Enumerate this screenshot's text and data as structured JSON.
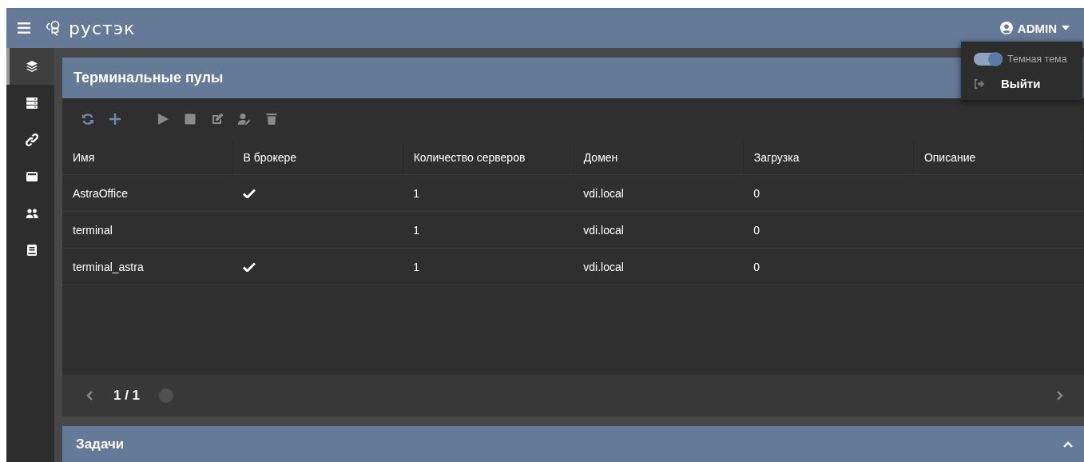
{
  "header": {
    "logo_text": "рустэк",
    "user": "ADMIN"
  },
  "user_menu": {
    "theme_toggle": {
      "label": "Темная тема",
      "on": true
    },
    "logout": "Выйти"
  },
  "sidebar": {
    "items": [
      {
        "selected": true
      },
      {
        "selected": false
      },
      {
        "selected": false
      },
      {
        "selected": false
      },
      {
        "selected": false
      },
      {
        "selected": false
      }
    ]
  },
  "panel": {
    "title": "Терминальные пулы",
    "toolbar": [
      {
        "disabled": false
      },
      {
        "disabled": false
      },
      {
        "disabled": true
      },
      {
        "disabled": true
      },
      {
        "disabled": true
      },
      {
        "disabled": true
      },
      {
        "disabled": true
      }
    ],
    "table": {
      "columns": [
        "Имя",
        "В брокере",
        "Количество серверов",
        "Домен",
        "Загрузка",
        "Описание"
      ],
      "rows": [
        {
          "name": "AstraOffice",
          "in_broker": true,
          "servers": "1",
          "domain": "vdi.local",
          "load": "0"
        },
        {
          "name": "terminal",
          "in_broker": false,
          "servers": "1",
          "domain": "vdi.local",
          "load": "0"
        },
        {
          "name": "terminal_astra",
          "in_broker": true,
          "servers": "1",
          "domain": "vdi.local",
          "load": "0"
        }
      ]
    },
    "pagination": {
      "page": "1 / 1"
    }
  },
  "tasks": {
    "title": "Задачи"
  }
}
